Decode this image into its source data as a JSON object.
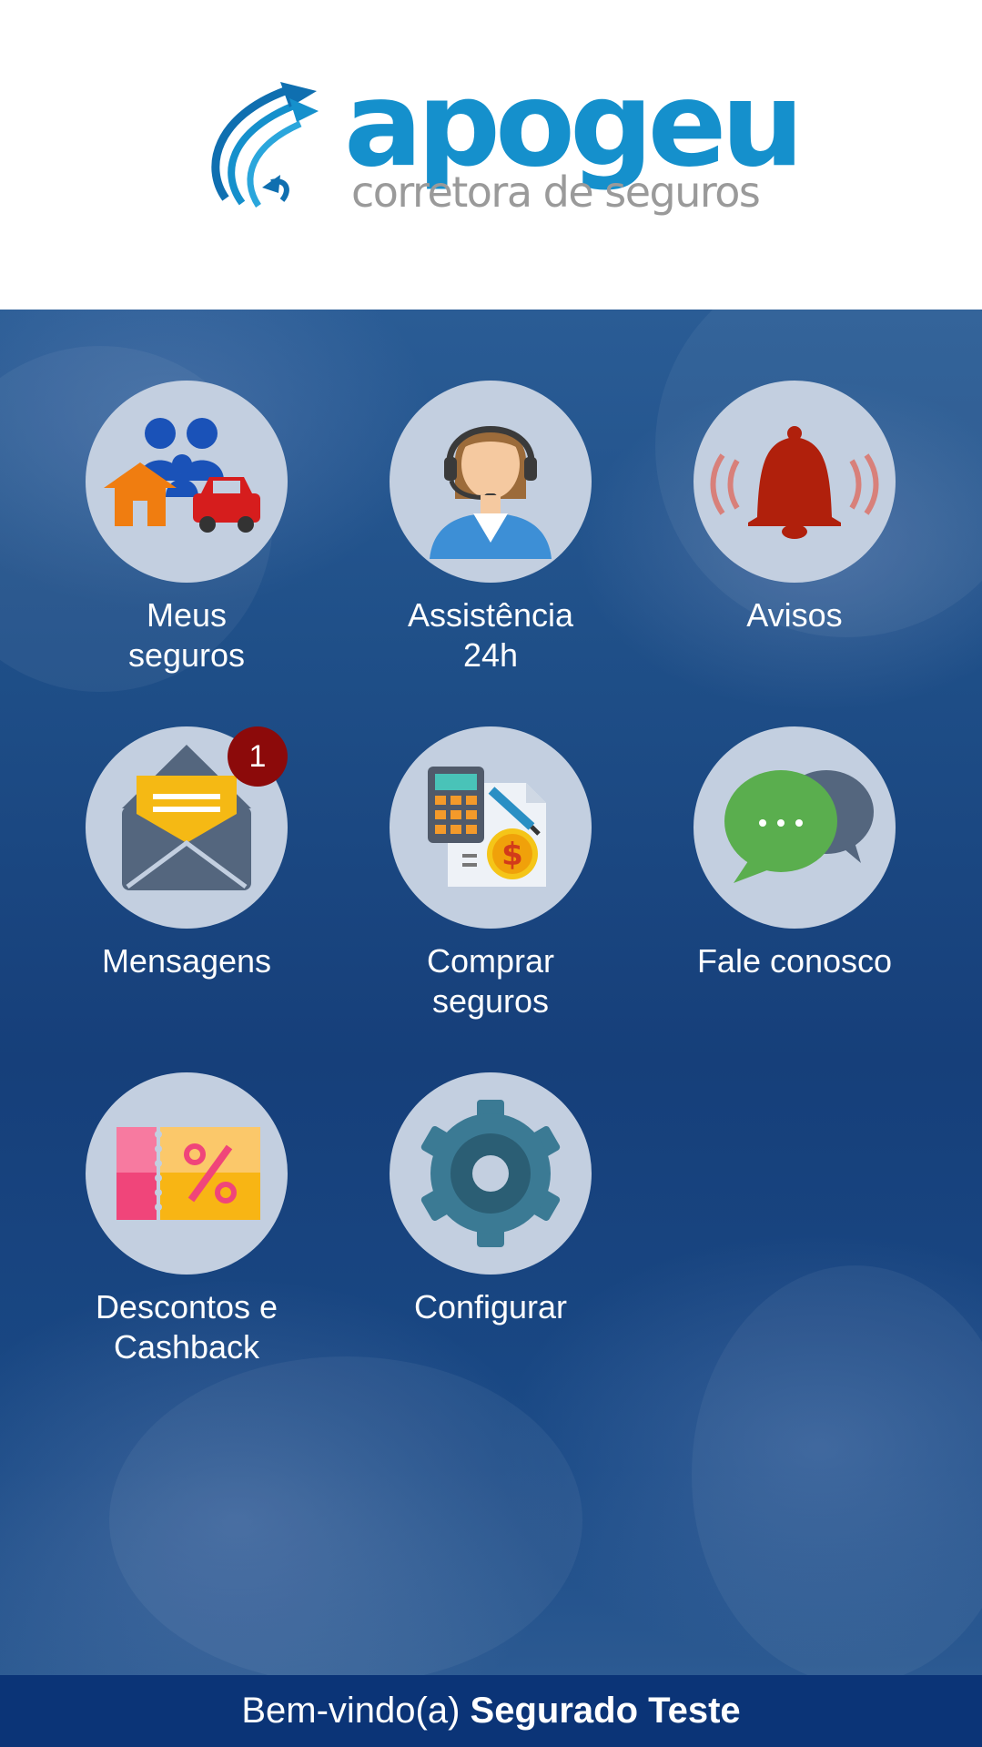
{
  "header": {
    "logo": {
      "name": "apogeu",
      "tagline": "corretora de seguros",
      "brand_color": "#1590cc",
      "tagline_color": "#9a9a9a",
      "icon": "arrows-swirl-logo-icon"
    }
  },
  "menu": {
    "items": [
      {
        "label": "Meus\nseguros",
        "icon": "family-home-car-icon"
      },
      {
        "label": "Assistência\n24h",
        "icon": "call-center-agent-icon"
      },
      {
        "label": "Avisos",
        "icon": "alarm-bell-icon"
      },
      {
        "label": "Mensagens",
        "icon": "envelope-icon",
        "badge": "1"
      },
      {
        "label": "Comprar\nseguros",
        "icon": "calculator-document-icon"
      },
      {
        "label": "Fale conosco",
        "icon": "chat-bubbles-icon"
      },
      {
        "label": "Descontos e\nCashback",
        "icon": "discount-ticket-icon"
      },
      {
        "label": "Configurar",
        "icon": "gear-icon"
      }
    ]
  },
  "footer": {
    "greeting": "Bem-vindo(a) ",
    "user_name": "Segurado Teste"
  },
  "colors": {
    "background_blue": "#1f4f88",
    "footer_blue": "#0b3477",
    "badge_red": "#8c0a0a",
    "circle_bg": "#c3cfe0"
  }
}
